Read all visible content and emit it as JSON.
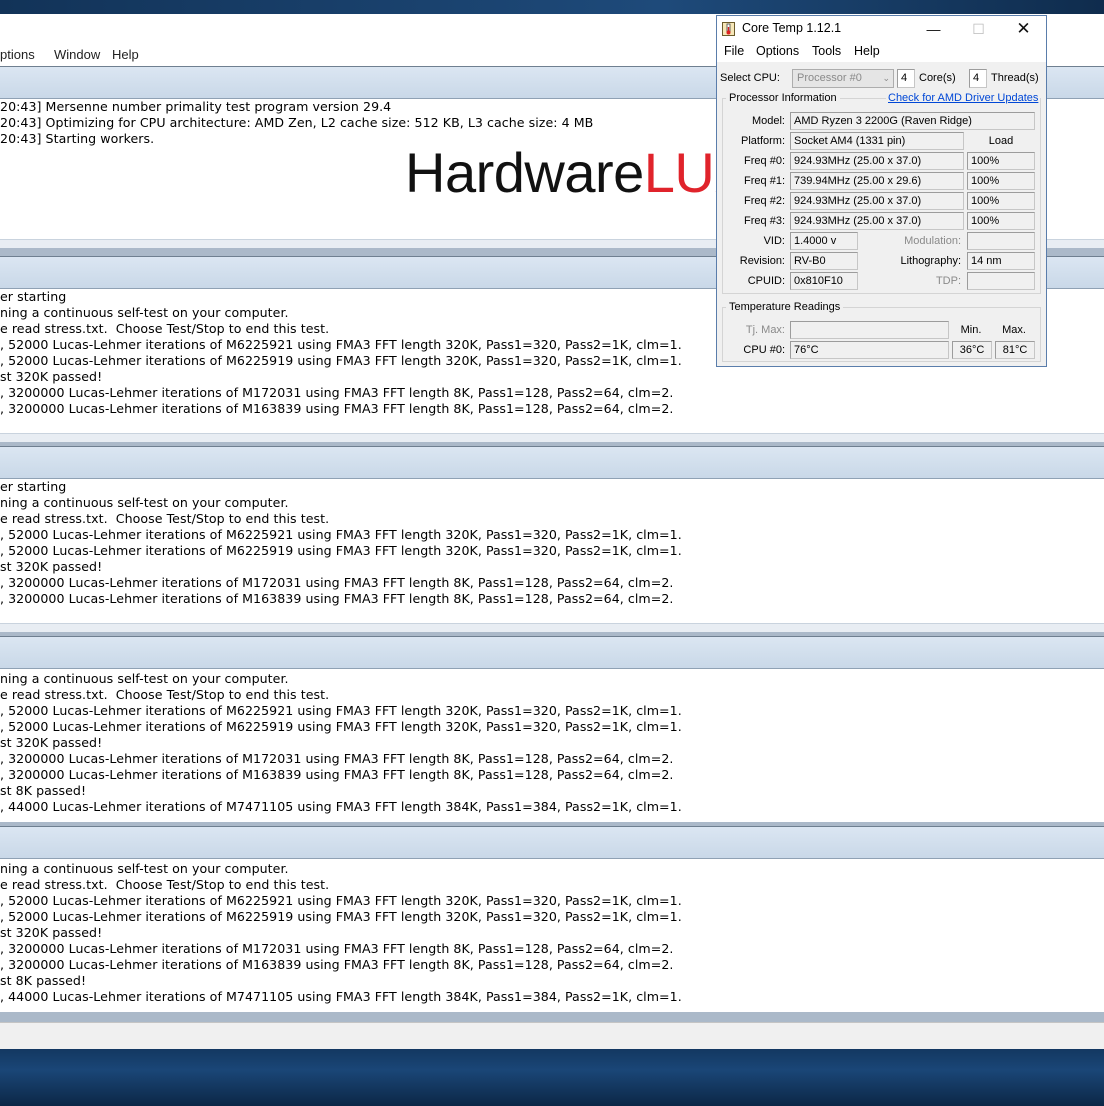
{
  "prime95": {
    "menu": [
      {
        "label": "ptions"
      },
      {
        "label": "Window"
      },
      {
        "label": "Help"
      }
    ],
    "main_log": [
      "20:43] Mersenne number primality test program version 29.4",
      "20:43] Optimizing for CPU architecture: AMD Zen, L2 cache size: 512 KB, L3 cache size: 4 MB",
      "20:43] Starting workers."
    ],
    "worker1_log": [
      "er starting",
      "ning a continuous self-test on your computer.",
      "e read stress.txt.  Choose Test/Stop to end this test.",
      ", 52000 Lucas-Lehmer iterations of M6225921 using FMA3 FFT length 320K, Pass1=320, Pass2=1K, clm=1.",
      ", 52000 Lucas-Lehmer iterations of M6225919 using FMA3 FFT length 320K, Pass1=320, Pass2=1K, clm=1.",
      "st 320K passed!",
      ", 3200000 Lucas-Lehmer iterations of M172031 using FMA3 FFT length 8K, Pass1=128, Pass2=64, clm=2.",
      ", 3200000 Lucas-Lehmer iterations of M163839 using FMA3 FFT length 8K, Pass1=128, Pass2=64, clm=2."
    ],
    "worker2_log": [
      "er starting",
      "ning a continuous self-test on your computer.",
      "e read stress.txt.  Choose Test/Stop to end this test.",
      ", 52000 Lucas-Lehmer iterations of M6225921 using FMA3 FFT length 320K, Pass1=320, Pass2=1K, clm=1.",
      ", 52000 Lucas-Lehmer iterations of M6225919 using FMA3 FFT length 320K, Pass1=320, Pass2=1K, clm=1.",
      "st 320K passed!",
      ", 3200000 Lucas-Lehmer iterations of M172031 using FMA3 FFT length 8K, Pass1=128, Pass2=64, clm=2.",
      ", 3200000 Lucas-Lehmer iterations of M163839 using FMA3 FFT length 8K, Pass1=128, Pass2=64, clm=2."
    ],
    "worker3_log": [
      "ning a continuous self-test on your computer.",
      "e read stress.txt.  Choose Test/Stop to end this test.",
      ", 52000 Lucas-Lehmer iterations of M6225921 using FMA3 FFT length 320K, Pass1=320, Pass2=1K, clm=1.",
      ", 52000 Lucas-Lehmer iterations of M6225919 using FMA3 FFT length 320K, Pass1=320, Pass2=1K, clm=1.",
      "st 320K passed!",
      ", 3200000 Lucas-Lehmer iterations of M172031 using FMA3 FFT length 8K, Pass1=128, Pass2=64, clm=2.",
      ", 3200000 Lucas-Lehmer iterations of M163839 using FMA3 FFT length 8K, Pass1=128, Pass2=64, clm=2.",
      "st 8K passed!",
      ", 44000 Lucas-Lehmer iterations of M7471105 using FMA3 FFT length 384K, Pass1=384, Pass2=1K, clm=1."
    ],
    "worker4_log": [
      "ning a continuous self-test on your computer.",
      "e read stress.txt.  Choose Test/Stop to end this test.",
      ", 52000 Lucas-Lehmer iterations of M6225921 using FMA3 FFT length 320K, Pass1=320, Pass2=1K, clm=1.",
      ", 52000 Lucas-Lehmer iterations of M6225919 using FMA3 FFT length 320K, Pass1=320, Pass2=1K, clm=1.",
      "st 320K passed!",
      ", 3200000 Lucas-Lehmer iterations of M172031 using FMA3 FFT length 8K, Pass1=128, Pass2=64, clm=2.",
      ", 3200000 Lucas-Lehmer iterations of M163839 using FMA3 FFT length 8K, Pass1=128, Pass2=64, clm=2.",
      "st 8K passed!",
      ", 44000 Lucas-Lehmer iterations of M7471105 using FMA3 FFT length 384K, Pass1=384, Pass2=1K, clm=1."
    ]
  },
  "watermark": {
    "part1": "Hardware",
    "part2": "LUXX",
    "color1": "#111111",
    "color2": "#e0232b"
  },
  "coretemp": {
    "title": "Core Temp 1.12.1",
    "menu": [
      "File",
      "Options",
      "Tools",
      "Help"
    ],
    "select_cpu_label": "Select CPU:",
    "processor_select": "Processor #0",
    "cores_value": "4",
    "cores_label": "Core(s)",
    "threads_value": "4",
    "threads_label": "Thread(s)",
    "proc_info_label": "Processor Information",
    "driver_link": "Check for AMD Driver Updates",
    "model_label": "Model:",
    "model_value": "AMD Ryzen 3 2200G (Raven Ridge)",
    "platform_label": "Platform:",
    "platform_value": "Socket AM4 (1331 pin)",
    "load_header": "Load",
    "freqs": [
      {
        "label": "Freq #0:",
        "value": "924.93MHz (25.00 x 37.0)",
        "load": "100%"
      },
      {
        "label": "Freq #1:",
        "value": "739.94MHz (25.00 x 29.6)",
        "load": "100%"
      },
      {
        "label": "Freq #2:",
        "value": "924.93MHz (25.00 x 37.0)",
        "load": "100%"
      },
      {
        "label": "Freq #3:",
        "value": "924.93MHz (25.00 x 37.0)",
        "load": "100%"
      }
    ],
    "vid_label": "VID:",
    "vid_value": "1.4000 v",
    "modulation_label": "Modulation:",
    "modulation_value": "",
    "revision_label": "Revision:",
    "revision_value": "RV-B0",
    "lithography_label": "Lithography:",
    "lithography_value": "14 nm",
    "cpuid_label": "CPUID:",
    "cpuid_value": "0x810F10",
    "tdp_label": "TDP:",
    "tdp_value": "",
    "temp_label": "Temperature Readings",
    "tjmax_label": "Tj. Max:",
    "tjmax_value": "",
    "min_header": "Min.",
    "max_header": "Max.",
    "cpu0_label": "CPU #0:",
    "cpu0_temp": "76°C",
    "cpu0_min": "36°C",
    "cpu0_max": "81°C"
  }
}
